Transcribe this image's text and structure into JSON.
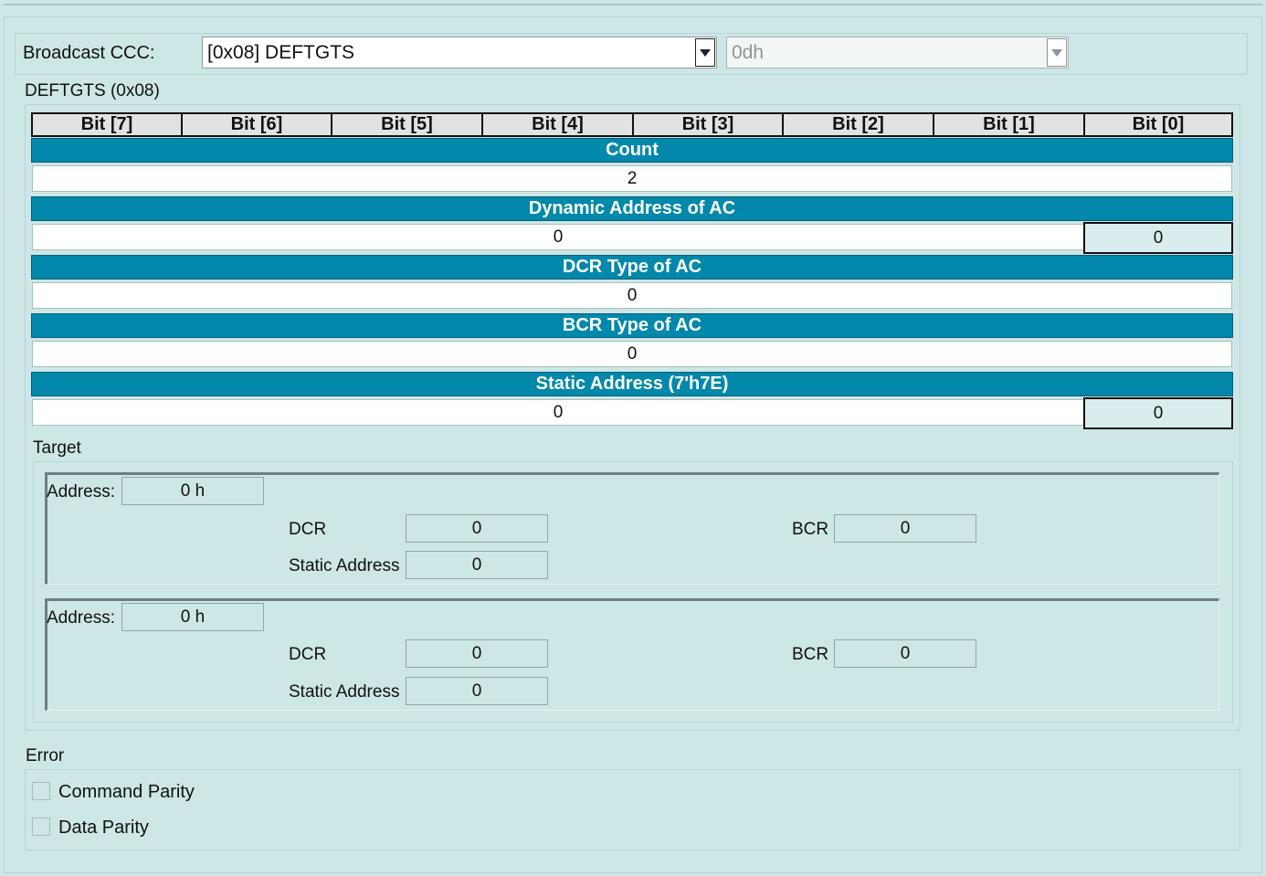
{
  "header": {
    "broadcast_label": "Broadcast CCC:",
    "ccc_value": "[0x08] DEFTGTS",
    "secondary_value": "0dh"
  },
  "deftgts": {
    "title": "DEFTGTS (0x08)",
    "bit_headers": [
      "Bit [7]",
      "Bit [6]",
      "Bit [5]",
      "Bit [4]",
      "Bit [3]",
      "Bit [2]",
      "Bit [1]",
      "Bit [0]"
    ],
    "count": {
      "label": "Count",
      "value": "2"
    },
    "dynamic_address": {
      "label": "Dynamic Address of AC",
      "value": "0",
      "bit0": "0"
    },
    "dcr_type": {
      "label": "DCR Type of AC",
      "value": "0"
    },
    "bcr_type": {
      "label": "BCR Type of AC",
      "value": "0"
    },
    "static_address": {
      "label": "Static Address (7'h7E)",
      "value": "0",
      "bit0": "0"
    }
  },
  "target": {
    "title": "Target",
    "address_label": "Address:",
    "dcr_label": "DCR",
    "static_address_label": "Static Address",
    "bcr_label": "BCR",
    "rows": [
      {
        "address": "0 h",
        "dcr": "0",
        "static_address": "0",
        "bcr": "0"
      },
      {
        "address": "0 h",
        "dcr": "0",
        "static_address": "0",
        "bcr": "0"
      }
    ]
  },
  "error": {
    "title": "Error",
    "command_parity": "Command Parity",
    "data_parity": "Data Parity"
  }
}
